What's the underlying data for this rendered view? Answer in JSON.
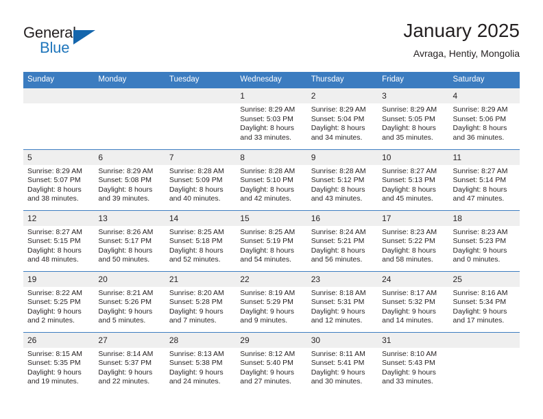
{
  "brand": {
    "name_part1": "General",
    "name_part2": "Blue",
    "triangle_color": "#1466ad",
    "blue_color": "#1e75bb"
  },
  "header": {
    "title": "January 2025",
    "subtitle": "Avraga, Hentiy, Mongolia"
  },
  "theme": {
    "header_row_bg": "#3b7cc0",
    "daynum_bg": "#efefef",
    "text_color": "#231f20",
    "row_divider": "#3b7cc0"
  },
  "weekdays": [
    "Sunday",
    "Monday",
    "Tuesday",
    "Wednesday",
    "Thursday",
    "Friday",
    "Saturday"
  ],
  "weeks": [
    [
      {
        "day": "",
        "sunrise": "",
        "sunset": "",
        "daylight1": "",
        "daylight2": ""
      },
      {
        "day": "",
        "sunrise": "",
        "sunset": "",
        "daylight1": "",
        "daylight2": ""
      },
      {
        "day": "",
        "sunrise": "",
        "sunset": "",
        "daylight1": "",
        "daylight2": ""
      },
      {
        "day": "1",
        "sunrise": "Sunrise: 8:29 AM",
        "sunset": "Sunset: 5:03 PM",
        "daylight1": "Daylight: 8 hours",
        "daylight2": "and 33 minutes."
      },
      {
        "day": "2",
        "sunrise": "Sunrise: 8:29 AM",
        "sunset": "Sunset: 5:04 PM",
        "daylight1": "Daylight: 8 hours",
        "daylight2": "and 34 minutes."
      },
      {
        "day": "3",
        "sunrise": "Sunrise: 8:29 AM",
        "sunset": "Sunset: 5:05 PM",
        "daylight1": "Daylight: 8 hours",
        "daylight2": "and 35 minutes."
      },
      {
        "day": "4",
        "sunrise": "Sunrise: 8:29 AM",
        "sunset": "Sunset: 5:06 PM",
        "daylight1": "Daylight: 8 hours",
        "daylight2": "and 36 minutes."
      }
    ],
    [
      {
        "day": "5",
        "sunrise": "Sunrise: 8:29 AM",
        "sunset": "Sunset: 5:07 PM",
        "daylight1": "Daylight: 8 hours",
        "daylight2": "and 38 minutes."
      },
      {
        "day": "6",
        "sunrise": "Sunrise: 8:29 AM",
        "sunset": "Sunset: 5:08 PM",
        "daylight1": "Daylight: 8 hours",
        "daylight2": "and 39 minutes."
      },
      {
        "day": "7",
        "sunrise": "Sunrise: 8:28 AM",
        "sunset": "Sunset: 5:09 PM",
        "daylight1": "Daylight: 8 hours",
        "daylight2": "and 40 minutes."
      },
      {
        "day": "8",
        "sunrise": "Sunrise: 8:28 AM",
        "sunset": "Sunset: 5:10 PM",
        "daylight1": "Daylight: 8 hours",
        "daylight2": "and 42 minutes."
      },
      {
        "day": "9",
        "sunrise": "Sunrise: 8:28 AM",
        "sunset": "Sunset: 5:12 PM",
        "daylight1": "Daylight: 8 hours",
        "daylight2": "and 43 minutes."
      },
      {
        "day": "10",
        "sunrise": "Sunrise: 8:27 AM",
        "sunset": "Sunset: 5:13 PM",
        "daylight1": "Daylight: 8 hours",
        "daylight2": "and 45 minutes."
      },
      {
        "day": "11",
        "sunrise": "Sunrise: 8:27 AM",
        "sunset": "Sunset: 5:14 PM",
        "daylight1": "Daylight: 8 hours",
        "daylight2": "and 47 minutes."
      }
    ],
    [
      {
        "day": "12",
        "sunrise": "Sunrise: 8:27 AM",
        "sunset": "Sunset: 5:15 PM",
        "daylight1": "Daylight: 8 hours",
        "daylight2": "and 48 minutes."
      },
      {
        "day": "13",
        "sunrise": "Sunrise: 8:26 AM",
        "sunset": "Sunset: 5:17 PM",
        "daylight1": "Daylight: 8 hours",
        "daylight2": "and 50 minutes."
      },
      {
        "day": "14",
        "sunrise": "Sunrise: 8:25 AM",
        "sunset": "Sunset: 5:18 PM",
        "daylight1": "Daylight: 8 hours",
        "daylight2": "and 52 minutes."
      },
      {
        "day": "15",
        "sunrise": "Sunrise: 8:25 AM",
        "sunset": "Sunset: 5:19 PM",
        "daylight1": "Daylight: 8 hours",
        "daylight2": "and 54 minutes."
      },
      {
        "day": "16",
        "sunrise": "Sunrise: 8:24 AM",
        "sunset": "Sunset: 5:21 PM",
        "daylight1": "Daylight: 8 hours",
        "daylight2": "and 56 minutes."
      },
      {
        "day": "17",
        "sunrise": "Sunrise: 8:23 AM",
        "sunset": "Sunset: 5:22 PM",
        "daylight1": "Daylight: 8 hours",
        "daylight2": "and 58 minutes."
      },
      {
        "day": "18",
        "sunrise": "Sunrise: 8:23 AM",
        "sunset": "Sunset: 5:23 PM",
        "daylight1": "Daylight: 9 hours",
        "daylight2": "and 0 minutes."
      }
    ],
    [
      {
        "day": "19",
        "sunrise": "Sunrise: 8:22 AM",
        "sunset": "Sunset: 5:25 PM",
        "daylight1": "Daylight: 9 hours",
        "daylight2": "and 2 minutes."
      },
      {
        "day": "20",
        "sunrise": "Sunrise: 8:21 AM",
        "sunset": "Sunset: 5:26 PM",
        "daylight1": "Daylight: 9 hours",
        "daylight2": "and 5 minutes."
      },
      {
        "day": "21",
        "sunrise": "Sunrise: 8:20 AM",
        "sunset": "Sunset: 5:28 PM",
        "daylight1": "Daylight: 9 hours",
        "daylight2": "and 7 minutes."
      },
      {
        "day": "22",
        "sunrise": "Sunrise: 8:19 AM",
        "sunset": "Sunset: 5:29 PM",
        "daylight1": "Daylight: 9 hours",
        "daylight2": "and 9 minutes."
      },
      {
        "day": "23",
        "sunrise": "Sunrise: 8:18 AM",
        "sunset": "Sunset: 5:31 PM",
        "daylight1": "Daylight: 9 hours",
        "daylight2": "and 12 minutes."
      },
      {
        "day": "24",
        "sunrise": "Sunrise: 8:17 AM",
        "sunset": "Sunset: 5:32 PM",
        "daylight1": "Daylight: 9 hours",
        "daylight2": "and 14 minutes."
      },
      {
        "day": "25",
        "sunrise": "Sunrise: 8:16 AM",
        "sunset": "Sunset: 5:34 PM",
        "daylight1": "Daylight: 9 hours",
        "daylight2": "and 17 minutes."
      }
    ],
    [
      {
        "day": "26",
        "sunrise": "Sunrise: 8:15 AM",
        "sunset": "Sunset: 5:35 PM",
        "daylight1": "Daylight: 9 hours",
        "daylight2": "and 19 minutes."
      },
      {
        "day": "27",
        "sunrise": "Sunrise: 8:14 AM",
        "sunset": "Sunset: 5:37 PM",
        "daylight1": "Daylight: 9 hours",
        "daylight2": "and 22 minutes."
      },
      {
        "day": "28",
        "sunrise": "Sunrise: 8:13 AM",
        "sunset": "Sunset: 5:38 PM",
        "daylight1": "Daylight: 9 hours",
        "daylight2": "and 24 minutes."
      },
      {
        "day": "29",
        "sunrise": "Sunrise: 8:12 AM",
        "sunset": "Sunset: 5:40 PM",
        "daylight1": "Daylight: 9 hours",
        "daylight2": "and 27 minutes."
      },
      {
        "day": "30",
        "sunrise": "Sunrise: 8:11 AM",
        "sunset": "Sunset: 5:41 PM",
        "daylight1": "Daylight: 9 hours",
        "daylight2": "and 30 minutes."
      },
      {
        "day": "31",
        "sunrise": "Sunrise: 8:10 AM",
        "sunset": "Sunset: 5:43 PM",
        "daylight1": "Daylight: 9 hours",
        "daylight2": "and 33 minutes."
      },
      {
        "day": "",
        "sunrise": "",
        "sunset": "",
        "daylight1": "",
        "daylight2": ""
      }
    ]
  ]
}
